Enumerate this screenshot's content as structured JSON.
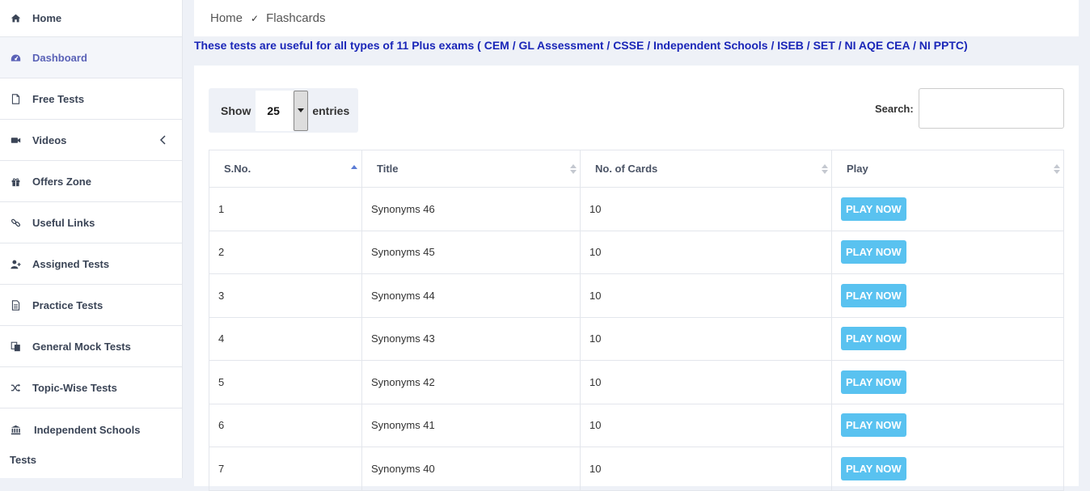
{
  "sidebar": {
    "items": [
      {
        "label": "Home",
        "icon": "home-icon"
      },
      {
        "label": "Dashboard",
        "icon": "dashboard-icon"
      },
      {
        "label": "Free Tests",
        "icon": "file-icon"
      },
      {
        "label": "Videos",
        "icon": "video-camera-icon"
      },
      {
        "label": "Offers Zone",
        "icon": "gift-icon"
      },
      {
        "label": "Useful Links",
        "icon": "link-icon"
      },
      {
        "label": "Assigned Tests",
        "icon": "user-plus-icon"
      },
      {
        "label": "Practice Tests",
        "icon": "document-icon"
      },
      {
        "label": "General Mock Tests",
        "icon": "copy-icon"
      },
      {
        "label": "Topic-Wise Tests",
        "icon": "shuffle-icon"
      },
      {
        "label": "Independent Schools",
        "label2": "Tests",
        "icon": "bank-icon"
      }
    ]
  },
  "breadcrumb": {
    "home": "Home",
    "separator": "✓",
    "current": "Flashcards"
  },
  "notice": "These tests are useful for all types of 11 Plus exams ( CEM / GL Assessment / CSSE / Independent Schools / ISEB / SET / NI AQE CEA / NI PPTC)",
  "table_controls": {
    "show_label": "Show",
    "entries_value": "25",
    "entries_label": "entries",
    "search_label": "Search:",
    "search_value": ""
  },
  "table": {
    "headers": [
      "S.No.",
      "Title",
      "No. of Cards",
      "Play"
    ],
    "rows": [
      {
        "sno": "1",
        "title": "Synonyms 46",
        "cards": "10",
        "action": "PLAY NOW"
      },
      {
        "sno": "2",
        "title": "Synonyms 45",
        "cards": "10",
        "action": "PLAY NOW"
      },
      {
        "sno": "3",
        "title": "Synonyms 44",
        "cards": "10",
        "action": "PLAY NOW"
      },
      {
        "sno": "4",
        "title": "Synonyms 43",
        "cards": "10",
        "action": "PLAY NOW"
      },
      {
        "sno": "5",
        "title": "Synonyms 42",
        "cards": "10",
        "action": "PLAY NOW"
      },
      {
        "sno": "6",
        "title": "Synonyms 41",
        "cards": "10",
        "action": "PLAY NOW"
      },
      {
        "sno": "7",
        "title": "Synonyms 40",
        "cards": "10",
        "action": "PLAY NOW"
      }
    ]
  },
  "colors": {
    "accent": "#5a62b7",
    "notice": "#1a26b8",
    "play_button": "#59c2f0"
  }
}
